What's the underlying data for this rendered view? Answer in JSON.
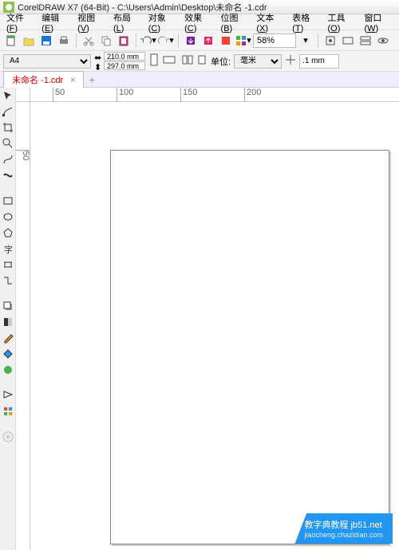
{
  "titlebar": {
    "app": "CorelDRAW X7 (64-Bit)",
    "path": "C:\\Users\\Admin\\Desktop\\未命名 -1.cdr"
  },
  "menu": {
    "file": "文件",
    "file_u": "F",
    "edit": "编辑",
    "edit_u": "E",
    "view": "视图",
    "view_u": "V",
    "layout": "布局",
    "layout_u": "L",
    "object": "对象",
    "object_u": "C",
    "effects": "效果",
    "effects_u": "C",
    "bitmap": "位图",
    "bitmap_u": "B",
    "text": "文本",
    "text_u": "X",
    "table": "表格",
    "table_u": "T",
    "tools": "工具",
    "tools_u": "O",
    "window": "窗口",
    "window_u": "W"
  },
  "toolbar": {
    "new": "new",
    "open": "open",
    "save": "save",
    "print": "print",
    "cut": "cut",
    "copy": "copy",
    "paste": "paste",
    "undo": "undo",
    "redo": "redo",
    "import": "import",
    "export": "export",
    "publish": "publish",
    "app": "app",
    "zoom_value": "58%"
  },
  "propbar": {
    "page_size": "A4",
    "width": "210.0 mm",
    "height": "297.0 mm",
    "units_label": "单位:",
    "units_value": "毫米",
    "nudge": ".1 mm"
  },
  "tabs": {
    "active": "未命名 -1.cdr"
  },
  "ruler": {
    "h": [
      "50",
      "100",
      "150",
      "200"
    ],
    "v": [
      "50"
    ]
  },
  "watermark": {
    "line1": "教字典教程 jb51.net",
    "line2": "jiaocheng.chazidian.com"
  },
  "icons": {
    "pick": "pick-tool",
    "shape": "shape-tool",
    "crop": "crop-tool",
    "zoom": "zoom-tool",
    "freehand": "freehand-tool",
    "artistic": "artistic-media-tool",
    "rect": "rectangle-tool",
    "ellipse": "ellipse-tool",
    "polygon": "polygon-tool",
    "text": "text-tool",
    "parallel": "parallel-dim-tool",
    "connector": "connector-tool",
    "dropshadow": "dropshadow-tool",
    "transparency": "transparency-tool",
    "eyedropper": "eyedropper-tool",
    "fill": "interactive-fill-tool",
    "smartfill": "smart-fill-tool",
    "outline": "outline-tool",
    "fillflyout": "fill-flyout",
    "plus": "quick-customize"
  }
}
